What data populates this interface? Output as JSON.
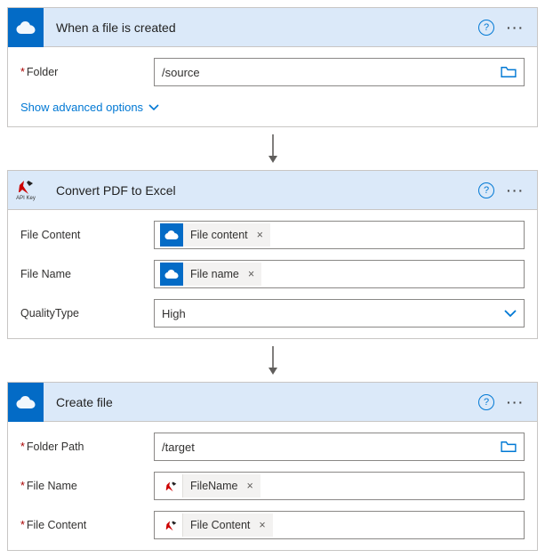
{
  "step1": {
    "title": "When a file is created",
    "folder_label": "Folder",
    "folder_value": "/source",
    "advanced_label": "Show advanced options"
  },
  "step2": {
    "title": "Convert PDF to Excel",
    "icon_caption": "API Key",
    "file_content_label": "File Content",
    "file_content_chip": "File content",
    "file_name_label": "File Name",
    "file_name_chip": "File name",
    "quality_label": "QualityType",
    "quality_value": "High"
  },
  "step3": {
    "title": "Create file",
    "folder_path_label": "Folder Path",
    "folder_path_value": "/target",
    "file_name_label": "File Name",
    "file_name_chip": "FileName",
    "file_content_label": "File Content",
    "file_content_chip": "File Content"
  }
}
